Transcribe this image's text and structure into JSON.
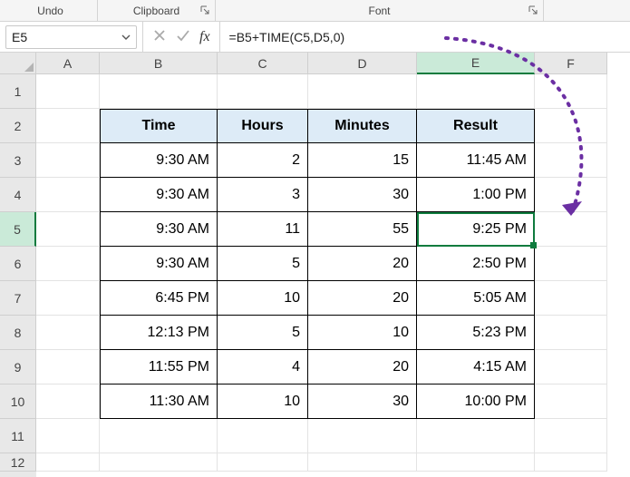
{
  "ribbon": {
    "undo_label": "Undo",
    "clipboard_label": "Clipboard",
    "font_label": "Font"
  },
  "namebox": {
    "value": "E5"
  },
  "formula": {
    "value": "=B5+TIME(C5,D5,0)"
  },
  "columns": [
    "A",
    "B",
    "C",
    "D",
    "E",
    "F"
  ],
  "rows": [
    "1",
    "2",
    "3",
    "4",
    "5",
    "6",
    "7",
    "8",
    "9",
    "10",
    "11",
    "12"
  ],
  "selected": {
    "row_index": 4,
    "col_index": 4
  },
  "table": {
    "headers": {
      "time": "Time",
      "hours": "Hours",
      "minutes": "Minutes",
      "result": "Result"
    },
    "rows": [
      {
        "time": "9:30 AM",
        "hours": "2",
        "minutes": "15",
        "result": "11:45 AM"
      },
      {
        "time": "9:30 AM",
        "hours": "3",
        "minutes": "30",
        "result": "1:00 PM"
      },
      {
        "time": "9:30 AM",
        "hours": "11",
        "minutes": "55",
        "result": "9:25 PM"
      },
      {
        "time": "9:30 AM",
        "hours": "5",
        "minutes": "20",
        "result": "2:50 PM"
      },
      {
        "time": "6:45 PM",
        "hours": "10",
        "minutes": "20",
        "result": "5:05 AM"
      },
      {
        "time": "12:13 PM",
        "hours": "5",
        "minutes": "10",
        "result": "5:23 PM"
      },
      {
        "time": "11:55 PM",
        "hours": "4",
        "minutes": "20",
        "result": "4:15 AM"
      },
      {
        "time": "11:30 AM",
        "hours": "10",
        "minutes": "30",
        "result": "10:00 PM"
      }
    ]
  }
}
